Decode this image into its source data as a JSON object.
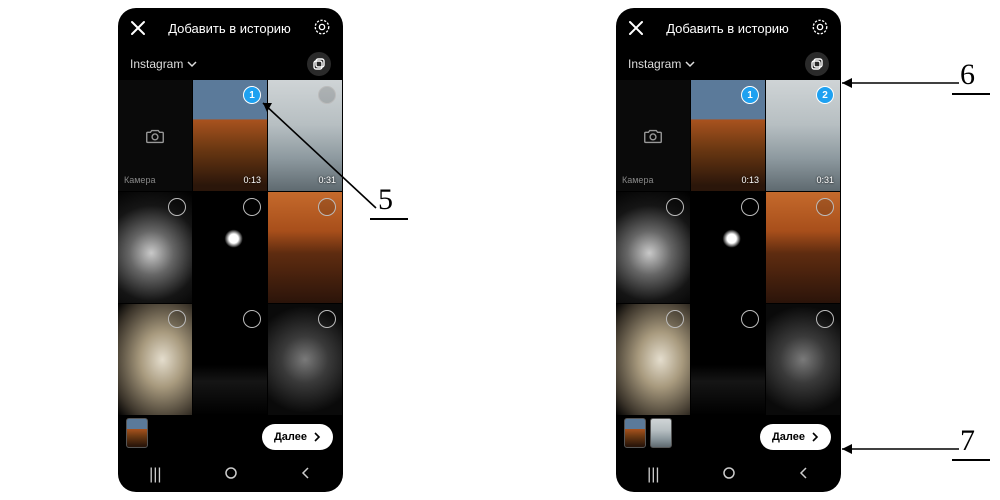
{
  "header": {
    "title": "Добавить в историю"
  },
  "album": {
    "name": "Instagram"
  },
  "camera": {
    "label": "Камера"
  },
  "cells": {
    "video1_duration": "0:13",
    "video2_duration": "0:31"
  },
  "selection": {
    "badge1": "1",
    "badge2": "2"
  },
  "next": {
    "label": "Далее"
  },
  "callouts": {
    "c5": "5",
    "c6": "6",
    "c7": "7"
  }
}
